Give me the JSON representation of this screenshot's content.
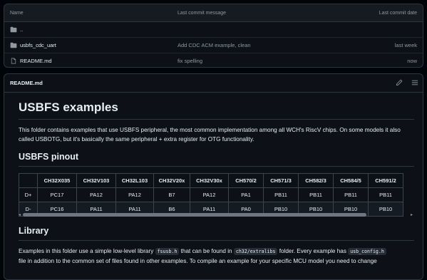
{
  "file_list": {
    "headers": {
      "name": "Name",
      "message": "Last commit message",
      "date": "Last commit date"
    },
    "rows": [
      {
        "name": "..",
        "icon": "folder-icon",
        "message": "",
        "date": ""
      },
      {
        "name": "usbfs_cdc_uart",
        "icon": "folder-icon",
        "message": "Add CDC ACM example, clean",
        "date": "last week"
      },
      {
        "name": "README.md",
        "icon": "file-icon",
        "message": "fix spelling",
        "date": "now"
      }
    ]
  },
  "readme": {
    "title": "README.md",
    "h1": "USBFS examples",
    "intro": "This folder contains examples that use USBFS peripheral, the most common implementation among all WCH's RiscV chips. On some models it also called USBOTG, but it's basically the same peripheral + extra register for OTG functionality.",
    "pinout_heading": "USBFS pinout",
    "table": {
      "headers": [
        "",
        "CH32X035",
        "CH32V103",
        "CH32L103",
        "CH32V20x",
        "CH32V30x",
        "CH570/2",
        "CH571/3",
        "CH582/3",
        "CH584/5",
        "CH591/2"
      ],
      "rows": [
        [
          "D+",
          "PC17",
          "PA12",
          "PA12",
          "B7",
          "PA12",
          "PA1",
          "PB11",
          "PB11",
          "PB11",
          "PB11"
        ],
        [
          "D-",
          "PC16",
          "PA11",
          "PA11",
          "B6",
          "PA11",
          "PA0",
          "PB10",
          "PB10",
          "PB10",
          "PB10"
        ]
      ]
    },
    "library_heading": "Library",
    "library_text": {
      "p1": "Examples in this folder use a simple low-level library ",
      "code1": "fsusb.h",
      "p2": " that can be found in ",
      "code2": "ch32/extralibs",
      "p3": " folder. Every example has ",
      "code3": "usb_config.h",
      "line2": "file in addition to the common set of files found in other examples. To compile an example for your specific MCU model you need to change"
    }
  },
  "colors": {
    "background": "#0d1117",
    "border": "#30363d",
    "text": "#e6edf3",
    "muted": "#9198a1"
  }
}
